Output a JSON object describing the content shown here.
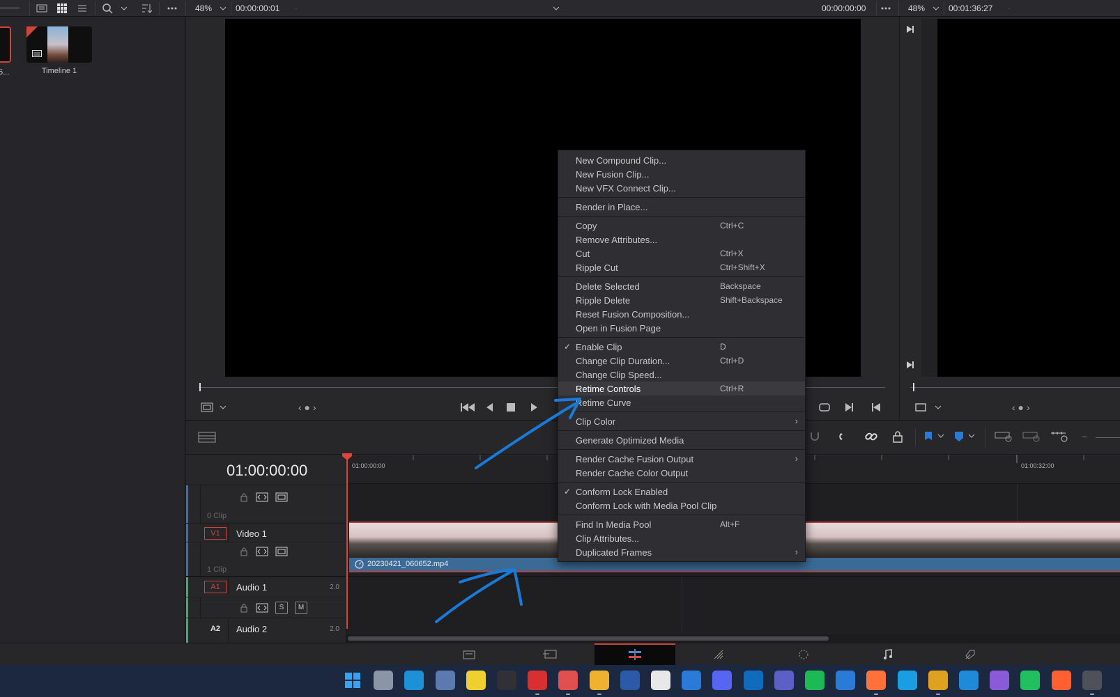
{
  "toolbar": {
    "source_zoom": "48%",
    "source_timecode": "00:00:00:01",
    "program_timecode": "00:00:00:00",
    "timeline_zoom": "48%",
    "timeline_duration": "00:01:36:27"
  },
  "media_pool": {
    "items": [
      {
        "label": "5..."
      },
      {
        "label": "Timeline 1"
      }
    ]
  },
  "timeline": {
    "current_timecode": "01:00:00:00",
    "ruler": [
      "01:00:00:00",
      "01:00:32:00"
    ],
    "tracks": [
      {
        "badge": "",
        "name": "",
        "count": "0 Clip"
      },
      {
        "badge": "V1",
        "name": "Video 1",
        "count": "1 Clip"
      },
      {
        "badge": "A1",
        "name": "Audio 1",
        "channels": "2.0",
        "solo": "S",
        "mute": "M"
      },
      {
        "badge": "A2",
        "name": "Audio 2",
        "channels": "2.0"
      }
    ],
    "clip_name": "20230421_060652.mp4"
  },
  "context_menu": {
    "groups": [
      [
        {
          "label": "New Compound Clip...",
          "shortcut": ""
        },
        {
          "label": "New Fusion Clip...",
          "shortcut": ""
        },
        {
          "label": "New VFX Connect Clip...",
          "shortcut": ""
        }
      ],
      [
        {
          "label": "Render in Place...",
          "shortcut": ""
        }
      ],
      [
        {
          "label": "Copy",
          "shortcut": "Ctrl+C"
        },
        {
          "label": "Remove Attributes...",
          "shortcut": ""
        },
        {
          "label": "Cut",
          "shortcut": "Ctrl+X"
        },
        {
          "label": "Ripple Cut",
          "shortcut": "Ctrl+Shift+X"
        }
      ],
      [
        {
          "label": "Delete Selected",
          "shortcut": "Backspace"
        },
        {
          "label": "Ripple Delete",
          "shortcut": "Shift+Backspace"
        },
        {
          "label": "Reset Fusion Composition...",
          "shortcut": ""
        },
        {
          "label": "Open in Fusion Page",
          "shortcut": ""
        }
      ],
      [
        {
          "label": "Enable Clip",
          "shortcut": "D",
          "checked": "✓"
        },
        {
          "label": "Change Clip Duration...",
          "shortcut": "Ctrl+D"
        },
        {
          "label": "Change Clip Speed...",
          "shortcut": ""
        },
        {
          "label": "Retime Controls",
          "shortcut": "Ctrl+R",
          "hover": true
        },
        {
          "label": "Retime Curve",
          "shortcut": ""
        }
      ],
      [
        {
          "label": "Clip Color",
          "shortcut": "",
          "submenu": "›"
        }
      ],
      [
        {
          "label": "Generate Optimized Media",
          "shortcut": ""
        }
      ],
      [
        {
          "label": "Render Cache Fusion Output",
          "shortcut": "",
          "submenu": "›"
        },
        {
          "label": "Render Cache Color Output",
          "shortcut": ""
        }
      ],
      [
        {
          "label": "Conform Lock Enabled",
          "shortcut": "",
          "checked": "✓"
        },
        {
          "label": "Conform Lock with Media Pool Clip",
          "shortcut": ""
        }
      ],
      [
        {
          "label": "Find In Media Pool",
          "shortcut": "Alt+F"
        },
        {
          "label": "Clip Attributes...",
          "shortcut": ""
        },
        {
          "label": "Duplicated Frames",
          "shortcut": "",
          "submenu": "›"
        }
      ]
    ]
  },
  "pages": [
    {
      "icon": "media-page-icon"
    },
    {
      "icon": "cut-page-icon"
    },
    {
      "icon": "edit-page-icon",
      "active": true
    },
    {
      "icon": "fusion-page-icon"
    },
    {
      "icon": "color-page-icon"
    },
    {
      "icon": "fairlight-page-icon"
    },
    {
      "icon": "deliver-page-icon"
    }
  ],
  "taskbar": {
    "icons": [
      {
        "icon": "windows-start-icon",
        "color": "#3aa0f0"
      },
      {
        "icon": "task-view-icon",
        "color": "#8a96a8"
      },
      {
        "icon": "l-app-icon",
        "color": "#1e90d8"
      },
      {
        "icon": "photos-icon",
        "color": "#5a7ab0"
      },
      {
        "icon": "sticky-notes-icon",
        "color": "#f0d030"
      },
      {
        "icon": "obs-icon",
        "color": "#303035"
      },
      {
        "icon": "flash-app-icon",
        "color": "#d83030"
      },
      {
        "icon": "snipping-tool-icon",
        "color": "#e05050"
      },
      {
        "icon": "file-explorer-icon",
        "color": "#f0b030"
      },
      {
        "icon": "powershell-icon",
        "color": "#2a5aa8"
      },
      {
        "icon": "clock-app-icon",
        "color": "#e8e8e8"
      },
      {
        "icon": "calendar-icon",
        "color": "#2a7ad8"
      },
      {
        "icon": "discord-icon",
        "color": "#5865f2"
      },
      {
        "icon": "outlook-icon",
        "color": "#0f6cbd"
      },
      {
        "icon": "teams-icon",
        "color": "#5b5fc7"
      },
      {
        "icon": "spotify-icon",
        "color": "#1db954"
      },
      {
        "icon": "todo-icon",
        "color": "#2a7ad8"
      },
      {
        "icon": "firefox-icon",
        "color": "#ff7139"
      },
      {
        "icon": "edge-icon",
        "color": "#1b9de2"
      },
      {
        "icon": "chrome-icon",
        "color": "#e0a020"
      },
      {
        "icon": "vscode-icon",
        "color": "#1f8ad8"
      },
      {
        "icon": "visual-studio-icon",
        "color": "#8a5ad8"
      },
      {
        "icon": "pycharm-icon",
        "color": "#20c060"
      },
      {
        "icon": "pen-app-icon",
        "color": "#ff6030"
      },
      {
        "icon": "davinci-resolve-icon",
        "color": "#505058"
      }
    ]
  },
  "colors": {
    "accent_red": "#d0453a",
    "clip_blue": "#3b6a95",
    "annotation_blue": "#1a7ad8",
    "video_track": "#3a6fb0",
    "audio_track": "#3ab070"
  }
}
